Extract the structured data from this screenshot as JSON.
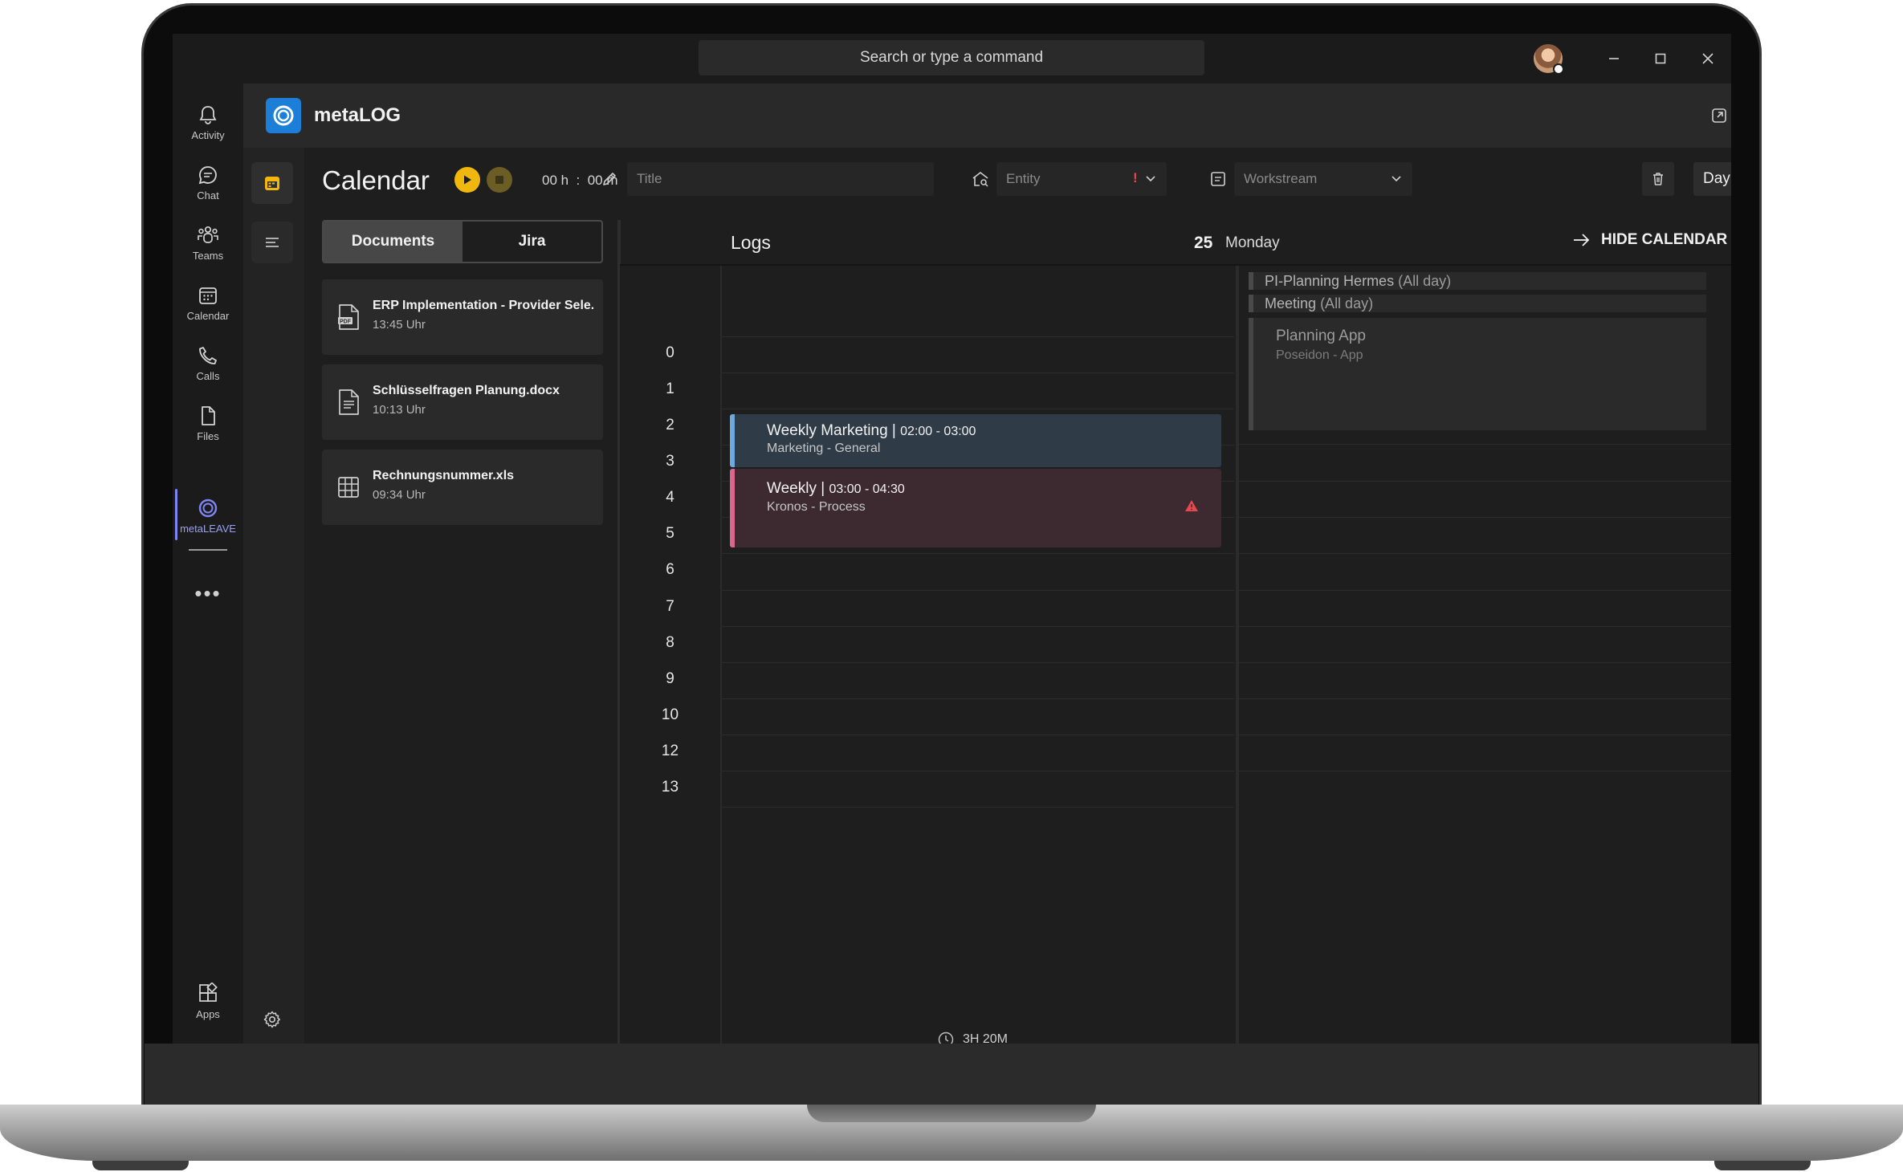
{
  "titlebar": {
    "search_placeholder": "Search or type a command"
  },
  "rail": {
    "items": [
      {
        "label": "Activity",
        "icon": "bell-icon"
      },
      {
        "label": "Chat",
        "icon": "chat-icon"
      },
      {
        "label": "Teams",
        "icon": "teams-icon"
      },
      {
        "label": "Calendar",
        "icon": "calendar-icon"
      },
      {
        "label": "Calls",
        "icon": "phone-icon"
      },
      {
        "label": "Files",
        "icon": "file-icon"
      },
      {
        "label": "metaLEAVE",
        "icon": "metaleave-icon"
      }
    ],
    "apps_label": "Apps",
    "more_label": "•••",
    "active_color": "#7f85f5"
  },
  "app": {
    "name": "metaLOG",
    "brand_color": "#1c7ed6"
  },
  "toolbar": {
    "page_title": "Calendar",
    "timer": "00 h  :  00 m",
    "title_placeholder": "Title",
    "entity_placeholder": "Entity",
    "entity_required_mark": "!",
    "workstream_placeholder": "Workstream",
    "view_mode": "Day",
    "play_color": "#f0b80e"
  },
  "documents_panel": {
    "tabs": [
      {
        "label": "Documents",
        "active": true
      },
      {
        "label": "Jira",
        "active": false
      }
    ],
    "items": [
      {
        "title": "ERP Implementation - Provider Sele...",
        "time": "13:45 Uhr",
        "icon": "pdf-file-icon"
      },
      {
        "title": "Schlüsselfragen Planung.docx",
        "time": "10:13 Uhr",
        "icon": "doc-file-icon"
      },
      {
        "title": "Rechnungsnummer.xls",
        "time": "09:34 Uhr",
        "icon": "spreadsheet-icon"
      }
    ]
  },
  "logs": {
    "header": "Logs",
    "day_number": "25",
    "day_name": "Monday",
    "hide_calendar_label": "HIDE CALENDAR",
    "hours": [
      "0",
      "1",
      "2",
      "3",
      "4",
      "5",
      "6",
      "7",
      "8",
      "9",
      "10",
      "12",
      "13"
    ],
    "entries": [
      {
        "title": "Weekly Marketing |",
        "time": "02:00 - 03:00",
        "subtitle": "Marketing - General",
        "accent": "#6fa8dc",
        "warning": false
      },
      {
        "title": "Weekly |",
        "time": "03:00 - 04:30",
        "subtitle": "Kronos - Process",
        "accent": "#d9668f",
        "warning": true
      }
    ],
    "total_duration": "3H 20M",
    "warning_color": "#e5484d"
  },
  "calendar": {
    "all_day_events": [
      {
        "title": "PI-Planning Hermes",
        "tag": "(All day)"
      },
      {
        "title": "Meeting",
        "tag": "(All day)"
      }
    ],
    "events": [
      {
        "title": "Planning App",
        "subtitle": "Poseidon - App"
      }
    ]
  }
}
